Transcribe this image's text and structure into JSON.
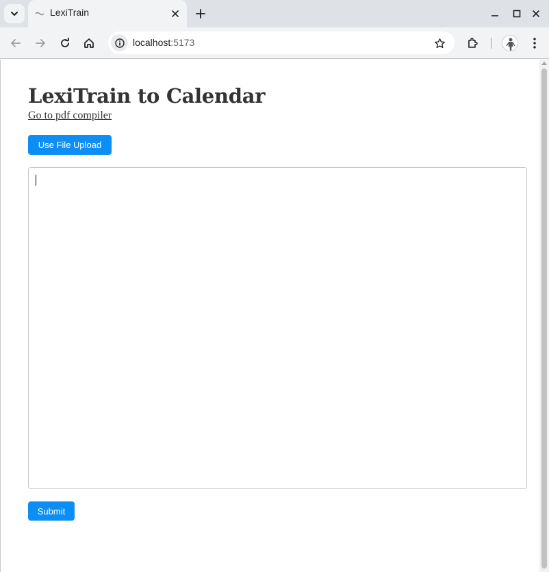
{
  "browser": {
    "tab_title": "LexiTrain",
    "url_host": "localhost",
    "url_port": ":5173"
  },
  "page": {
    "title": "LexiTrain to Calendar",
    "pdf_link": "Go to pdf compiler",
    "upload_button": "Use File Upload",
    "textarea_value": "",
    "submit_button": "Submit"
  },
  "colors": {
    "accent": "#0d8ef5",
    "text": "#333333",
    "chrome_bg": "#dee1e6",
    "toolbar_bg": "#f1f3f4"
  },
  "icons": [
    "tab-search-icon",
    "tab-favicon-icon",
    "close-icon",
    "plus-icon",
    "minimize-icon",
    "maximize-icon",
    "window-close-icon",
    "back-icon",
    "forward-icon",
    "reload-icon",
    "home-icon",
    "site-info-icon",
    "star-icon",
    "extensions-icon",
    "profile-avatar",
    "more-menu-icon"
  ]
}
